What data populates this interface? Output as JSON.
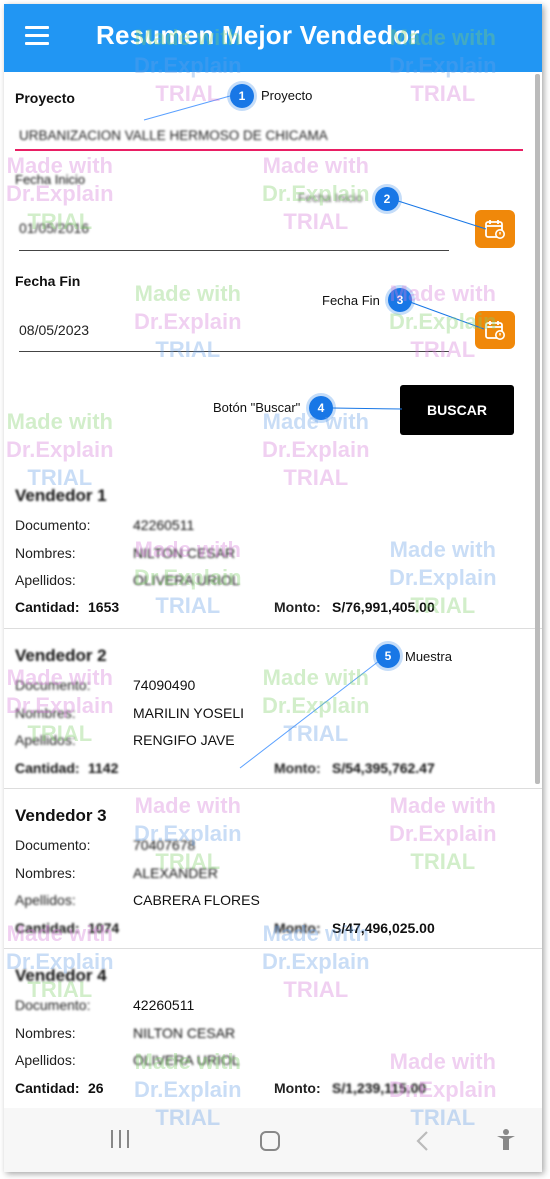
{
  "app": {
    "title": "Resumen Mejor Vendedor"
  },
  "form": {
    "proyecto_label": "Proyecto",
    "proyecto_value": "URBANIZACION VALLE HERMOSO DE CHICAMA",
    "fecha_inicio_label": "Fecha Inicio",
    "fecha_inicio_value": "01/05/2016",
    "fecha_fin_label": "Fecha Fin",
    "fecha_fin_value": "08/05/2023",
    "buscar_label": "BUSCAR"
  },
  "field_labels": {
    "documento": "Documento:",
    "nombres": "Nombres:",
    "apellidos": "Apellidos:",
    "cantidad": "Cantidad:",
    "monto": "Monto:"
  },
  "vendedores": [
    {
      "title": "Vendedor 1",
      "documento": "42260511",
      "nombres": "NILTON CESAR",
      "apellidos": "OLIVERA URIOL",
      "cantidad": "1653",
      "monto": "S/76,991,405.00"
    },
    {
      "title": "Vendedor 2",
      "documento": "74090490",
      "nombres": "MARILIN YOSELI",
      "apellidos": "RENGIFO JAVE",
      "cantidad": "1142",
      "monto": "S/54,395,762.47"
    },
    {
      "title": "Vendedor 3",
      "documento": "70407678",
      "nombres": "ALEXANDER",
      "apellidos": "CABRERA FLORES",
      "cantidad": "1074",
      "monto": "S/47,496,025.00"
    },
    {
      "title": "Vendedor 4",
      "documento": "42260511",
      "nombres": "NILTON CESAR",
      "apellidos": "OLIVERA URIOL",
      "cantidad": "26",
      "monto": "S/1,239,115.00"
    }
  ],
  "callouts": [
    {
      "number": "1",
      "text": "Proyecto"
    },
    {
      "number": "2",
      "text": "Fecha Inicio"
    },
    {
      "number": "3",
      "text": "Fecha Fin"
    },
    {
      "number": "4",
      "text": "Botón \"Buscar\""
    },
    {
      "number": "5",
      "text": "Muestra"
    }
  ],
  "watermark": {
    "line1": "Made with",
    "line2": "Dr.Explain",
    "line3": "TRIAL"
  },
  "navbar": {
    "recent_icon": "recent-apps-icon",
    "home_icon": "home-icon",
    "back_icon": "back-icon",
    "accessibility_icon": "accessibility-icon"
  },
  "colors": {
    "appbar": "#2196f3",
    "accent_orange": "#f0880a",
    "underline_pink": "#e91e63",
    "callout_blue": "#1877e6"
  }
}
